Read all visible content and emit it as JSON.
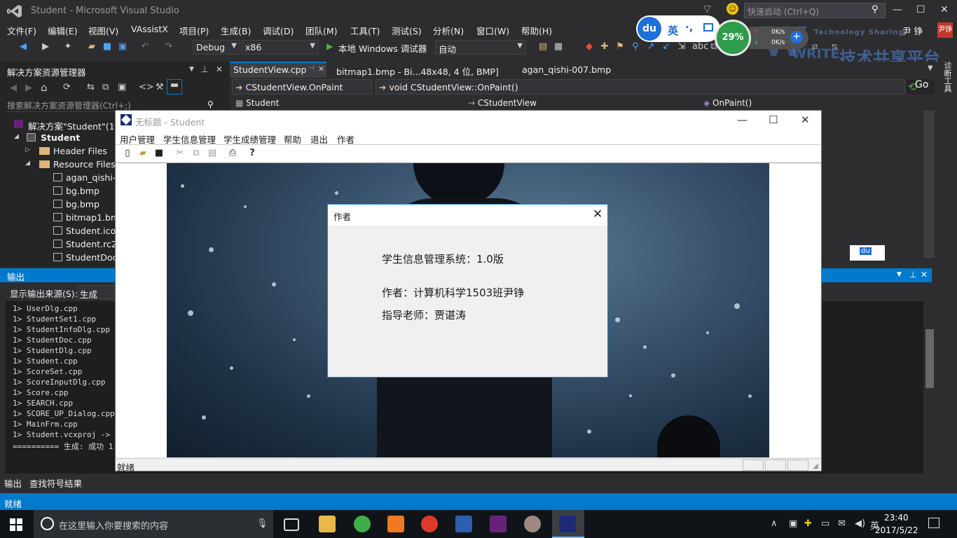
{
  "vs": {
    "title": "Student - Microsoft Visual Studio",
    "quick_launch_placeholder": "快速启动 (Ctrl+Q)",
    "user": "尹 铮",
    "menu": [
      "文件(F)",
      "编辑(E)",
      "视图(V)",
      "VAssistX",
      "项目(P)",
      "生成(B)",
      "调试(D)",
      "团队(M)",
      "工具(T)",
      "测试(S)",
      "分析(N)",
      "窗口(W)",
      "帮助(H)"
    ],
    "toolbar": {
      "config": "Debug",
      "platform": "x86",
      "run_label": "本地 Windows 调试器",
      "run_mode": "自动"
    },
    "status": "就绪",
    "user_avatar_text": "尹铮"
  },
  "ime": {
    "logo": "du",
    "lang": "英",
    "punct": "·,",
    "net_percent": "29%",
    "up_rate": "0K/s",
    "down_rate": "0K/s",
    "mini_logo": "du"
  },
  "watermark": {
    "logo": "W",
    "text": "WRITE",
    "sub": "Technology Sharing",
    "brand": "技术共享平台"
  },
  "solution_explorer": {
    "title": "解决方案资源管理器",
    "search_placeholder": "搜索解决方案资源管理器(Ctrl+;)",
    "items": [
      {
        "label": "解决方案\"Student\"(1 个"
      },
      {
        "label": "Student"
      },
      {
        "label": "Header Files"
      },
      {
        "label": "Resource Files"
      },
      {
        "label": "agan_qishi-0"
      },
      {
        "label": "bg.bmp"
      },
      {
        "label": "bg.bmp"
      },
      {
        "label": "bitmap1.bm"
      },
      {
        "label": "Student.ico"
      },
      {
        "label": "Student.rc2"
      },
      {
        "label": "StudentDoc."
      }
    ]
  },
  "editor": {
    "tabs": [
      "StudentView.cpp",
      "bitmap1.bmp - Bi...48x48, 4 位, BMP]",
      "agan_qishi-007.bmp"
    ],
    "nav_scope": "CStudentView.OnPaint",
    "nav_function": "void CStudentView::OnPaint()",
    "go_label": "Go",
    "project_box": "Student",
    "class_box": "CStudentView",
    "member_box": "OnPaint()",
    "side_tab": "诊断工具"
  },
  "output": {
    "title": "输出",
    "source_label": "显示输出来源(S):",
    "source_value": "生成",
    "lines": [
      "1>  UserDlg.cpp",
      "1>  StudentSet1.cpp",
      "1>  StudentInfoDlg.cpp",
      "1>  StudentDoc.cpp",
      "1>  StudentDlg.cpp",
      "1>  Student.cpp",
      "1>  ScoreSet.cpp",
      "1>  ScoreInputDlg.cpp",
      "1>  Score.cpp",
      "1>  SEARCH.cpp",
      "1>  SCORE_UP_Dialog.cpp",
      "1>  MainFrm.cpp",
      "1>  Student.vcxproj -> C",
      "========== 生成: 成功 1"
    ],
    "bottom_tabs": [
      "输出",
      "查找符号结果"
    ]
  },
  "app": {
    "title": "无标题 - Student",
    "menu": [
      "用户管理",
      "学生信息管理",
      "学生成绩管理",
      "帮助",
      "退出",
      "作者"
    ],
    "status": "就绪"
  },
  "about": {
    "title": "作者",
    "line1": "学生信息管理系统：1.0版",
    "line2": "作者：计算机科学1503班尹铮",
    "line3": "指导老师：贾谌涛"
  },
  "taskbar": {
    "search_placeholder": "在这里输入你要搜索的内容",
    "time": "23:40",
    "date": "2017/5/22"
  }
}
